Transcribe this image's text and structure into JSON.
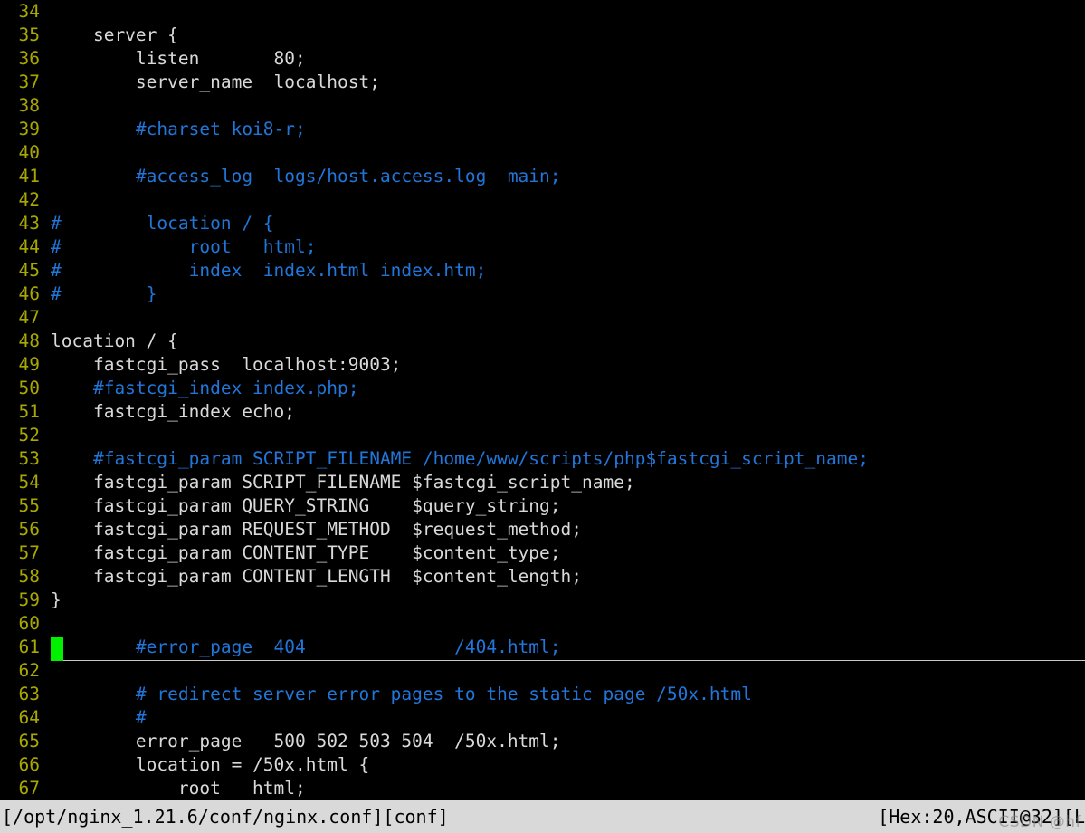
{
  "editor": {
    "first_visible_line": 34,
    "cursor_line": 61,
    "cursor_column": 1,
    "colors": {
      "background": "#000000",
      "line_number": "#a8a800",
      "code_text": "#d9d9d9",
      "comment_text": "#2176d9",
      "cursor_block": "#00f000",
      "cursorline_underline": "#c8c8c8",
      "status_background": "#d9d9d9",
      "status_text": "#000000"
    },
    "lines": [
      {
        "n": "34",
        "text": "",
        "kind": "code"
      },
      {
        "n": "35",
        "text": "    server {",
        "kind": "code"
      },
      {
        "n": "36",
        "text": "        listen       80;",
        "kind": "code"
      },
      {
        "n": "37",
        "text": "        server_name  localhost;",
        "kind": "code"
      },
      {
        "n": "38",
        "text": "",
        "kind": "code"
      },
      {
        "n": "39",
        "text": "        #charset koi8-r;",
        "kind": "comment"
      },
      {
        "n": "40",
        "text": "",
        "kind": "code"
      },
      {
        "n": "41",
        "text": "        #access_log  logs/host.access.log  main;",
        "kind": "comment"
      },
      {
        "n": "42",
        "text": "",
        "kind": "code"
      },
      {
        "n": "43",
        "text": "#        location / {",
        "kind": "comment"
      },
      {
        "n": "44",
        "text": "#            root   html;",
        "kind": "comment"
      },
      {
        "n": "45",
        "text": "#            index  index.html index.htm;",
        "kind": "comment"
      },
      {
        "n": "46",
        "text": "#        }",
        "kind": "comment"
      },
      {
        "n": "47",
        "text": "",
        "kind": "code"
      },
      {
        "n": "48",
        "text": "location / {",
        "kind": "code"
      },
      {
        "n": "49",
        "text": "    fastcgi_pass  localhost:9003;",
        "kind": "code"
      },
      {
        "n": "50",
        "text": "    #fastcgi_index index.php;",
        "kind": "comment"
      },
      {
        "n": "51",
        "text": "    fastcgi_index echo;",
        "kind": "code"
      },
      {
        "n": "52",
        "text": "",
        "kind": "code"
      },
      {
        "n": "53",
        "text": "    #fastcgi_param SCRIPT_FILENAME /home/www/scripts/php$fastcgi_script_name;",
        "kind": "comment"
      },
      {
        "n": "54",
        "text": "    fastcgi_param SCRIPT_FILENAME $fastcgi_script_name;",
        "kind": "code"
      },
      {
        "n": "55",
        "text": "    fastcgi_param QUERY_STRING    $query_string;",
        "kind": "code"
      },
      {
        "n": "56",
        "text": "    fastcgi_param REQUEST_METHOD  $request_method;",
        "kind": "code"
      },
      {
        "n": "57",
        "text": "    fastcgi_param CONTENT_TYPE    $content_type;",
        "kind": "code"
      },
      {
        "n": "58",
        "text": "    fastcgi_param CONTENT_LENGTH  $content_length;",
        "kind": "code"
      },
      {
        "n": "59",
        "text": "}",
        "kind": "code"
      },
      {
        "n": "60",
        "text": "",
        "kind": "code"
      },
      {
        "n": "61",
        "text": "        #error_page  404              /404.html;",
        "kind": "comment",
        "cursor": true
      },
      {
        "n": "62",
        "text": "",
        "kind": "code"
      },
      {
        "n": "63",
        "text": "        # redirect server error pages to the static page /50x.html",
        "kind": "comment"
      },
      {
        "n": "64",
        "text": "        #",
        "kind": "comment"
      },
      {
        "n": "65",
        "text": "        error_page   500 502 503 504  /50x.html;",
        "kind": "code"
      },
      {
        "n": "66",
        "text": "        location = /50x.html {",
        "kind": "code"
      },
      {
        "n": "67",
        "text": "            root   html;",
        "kind": "code"
      }
    ]
  },
  "status_bar": {
    "file_info": "[/opt/nginx_1.21.6/conf/nginx.conf][conf]",
    "cursor_info": "[Hex:20,ASCII@32][L"
  },
  "watermark": {
    "text": "CSDN @hf"
  }
}
